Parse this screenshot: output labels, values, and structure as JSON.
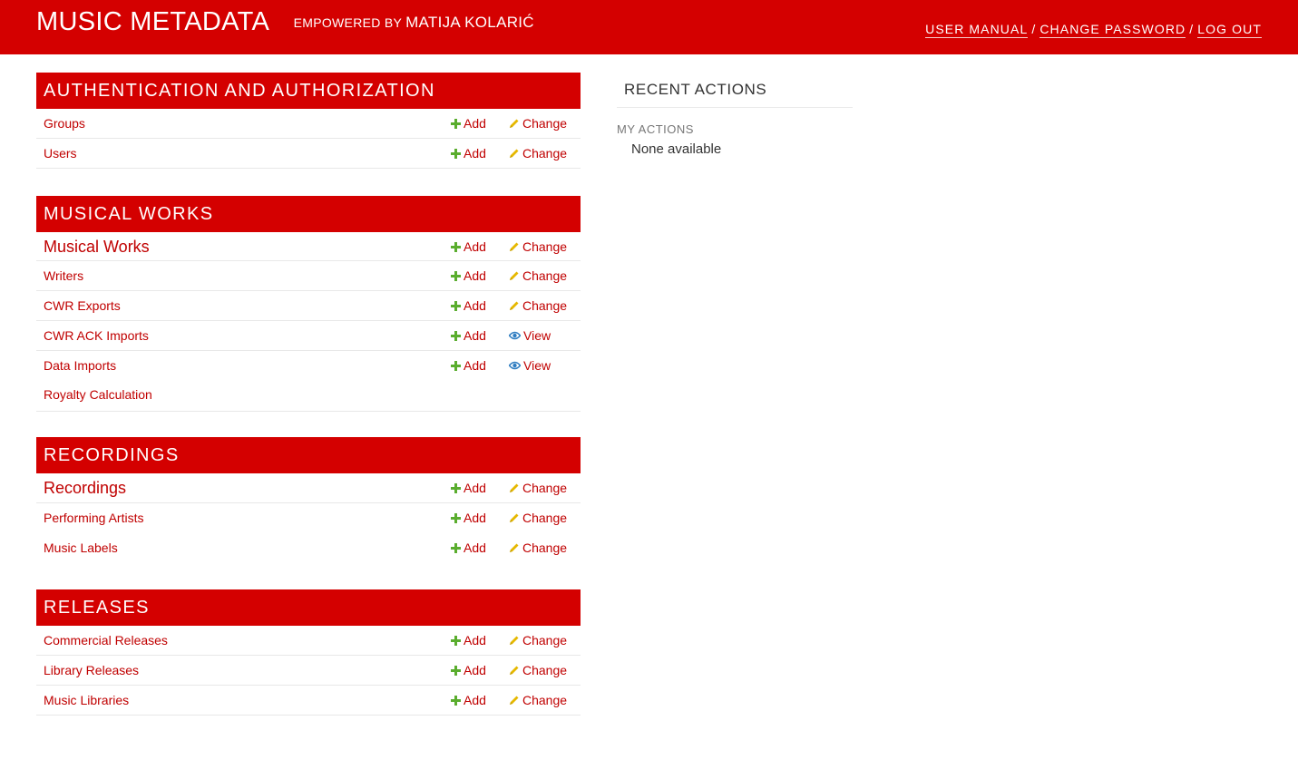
{
  "header": {
    "site_name": "MUSIC METADATA",
    "powered_prefix": "EMPOWERED BY",
    "powered_author": "MATIJA KOLARIĆ",
    "user_manual": "USER MANUAL",
    "change_password": "CHANGE PASSWORD",
    "log_out": "LOG OUT",
    "separator": "/"
  },
  "colors": {
    "brand_red": "#d40000",
    "link_red": "#c00000",
    "add_green": "#5aad2e",
    "change_yellow": "#e6b800",
    "view_blue": "#2f7dc1"
  },
  "labels": {
    "add": "Add",
    "change": "Change",
    "view": "View"
  },
  "modules": {
    "auth": {
      "caption": "AUTHENTICATION AND AUTHORIZATION",
      "rows": [
        {
          "name": "Groups",
          "action": "Change"
        },
        {
          "name": "Users",
          "action": "Change"
        }
      ]
    },
    "works": {
      "caption": "MUSICAL WORKS",
      "rows": [
        {
          "name": "Musical Works",
          "action": "Change"
        },
        {
          "name": "Writers",
          "action": "Change"
        },
        {
          "name": "CWR Exports",
          "action": "Change"
        },
        {
          "name": "CWR ACK Imports",
          "action": "View"
        },
        {
          "name": "Data Imports",
          "action": "View"
        },
        {
          "name": "Royalty Calculation",
          "action": ""
        }
      ]
    },
    "recordings": {
      "caption": "RECORDINGS",
      "rows": [
        {
          "name": "Recordings",
          "action": "Change"
        },
        {
          "name": "Performing Artists",
          "action": "Change"
        },
        {
          "name": "Music Labels",
          "action": "Change"
        }
      ]
    },
    "releases": {
      "caption": "RELEASES",
      "rows": [
        {
          "name": "Commercial Releases",
          "action": "Change"
        },
        {
          "name": "Library Releases",
          "action": "Change"
        },
        {
          "name": "Music Libraries",
          "action": "Change"
        }
      ]
    }
  },
  "recent_actions": {
    "title": "RECENT ACTIONS",
    "my_actions": "MY ACTIONS",
    "empty": "None available"
  }
}
